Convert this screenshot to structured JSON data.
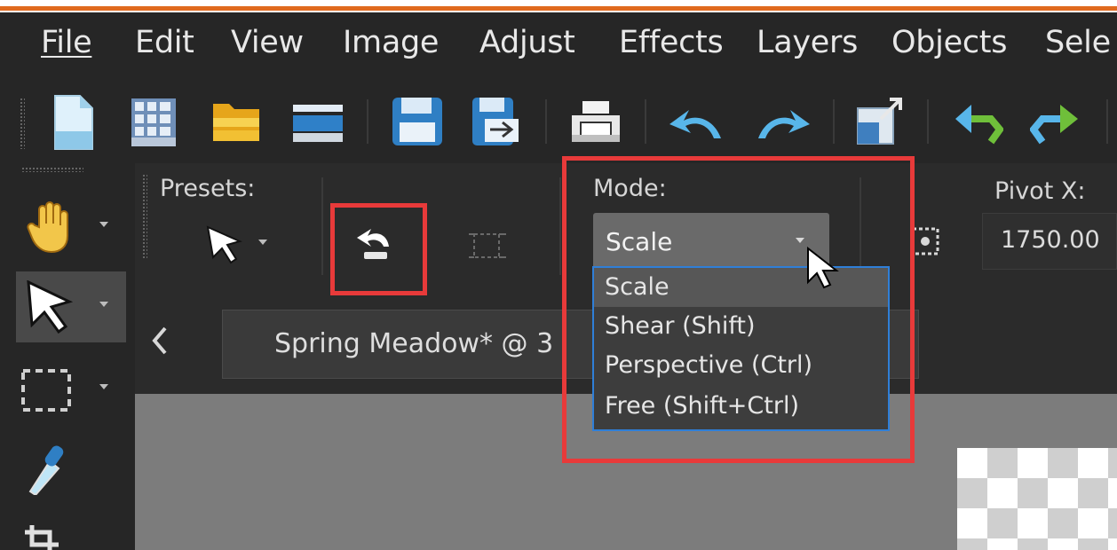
{
  "menu": {
    "file": "File",
    "edit": "Edit",
    "view": "View",
    "image": "Image",
    "adjust": "Adjust",
    "effects": "Effects",
    "layers": "Layers",
    "objects": "Objects",
    "selections": "Sele"
  },
  "tool_options": {
    "presets_label": "Presets:",
    "mode_label": "Mode:",
    "mode_value": "Scale",
    "pivot_x_label": "Pivot X:",
    "pivot_x_value": "1750.00",
    "mode_options": [
      "Scale",
      "Shear (Shift)",
      "Perspective (Ctrl)",
      "Free (Shift+Ctrl)"
    ]
  },
  "document_tab": {
    "title": "Spring Meadow* @ 3"
  },
  "colors": {
    "highlight": "#e83a3a",
    "accent_bar": "#e06a1f",
    "dropdown_border": "#2f7fd8"
  }
}
